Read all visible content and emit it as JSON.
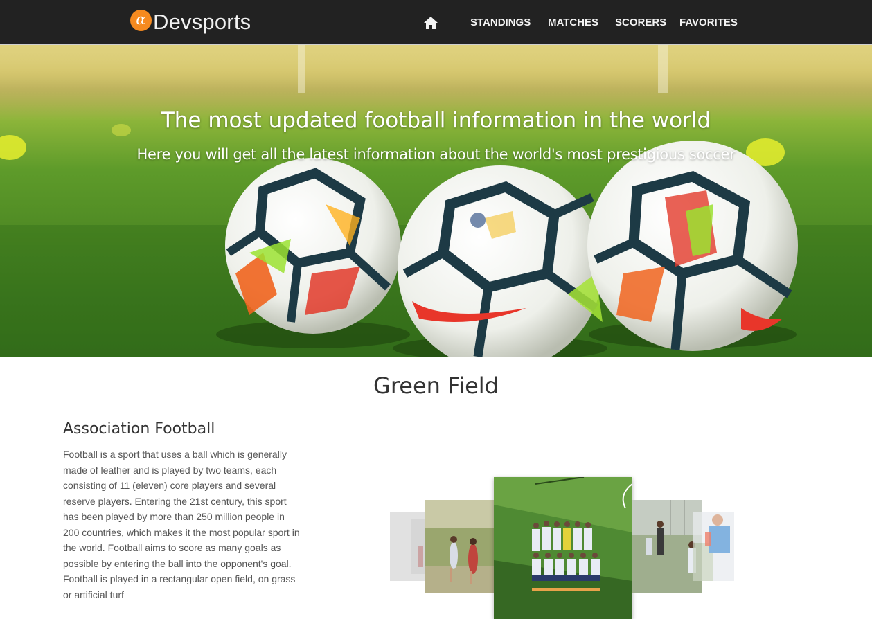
{
  "header": {
    "brand_logo_glyph": "α",
    "brand_name": "Devsports",
    "home_icon": "home-icon",
    "nav": {
      "standings": "STANDINGS",
      "matches": "MATCHES",
      "scorers": "SCORERS",
      "favorites": "FAVORITES"
    }
  },
  "hero": {
    "title": "The most updated football information in the world",
    "subtitle": "Here you will get all the latest information about the world's most prestigious soccer"
  },
  "section": {
    "title": "Green Field"
  },
  "article": {
    "title": "Association Football",
    "body": "Football is a sport that uses a ball which is generally made of leather and is played by two teams, each consisting of 11 (eleven) core players and several reserve players. Entering the 21st century, this sport has been played by more than 250 million people in 200 countries, which makes it the most popular sport in the world. Football aims to score as many goals as possible by entering the ball into the opponent's goal. Football is played in a rectangular open field, on grass or artificial turf"
  },
  "colors": {
    "header_bg": "#222222",
    "brand_accent": "#f58a1f",
    "text_dark": "#333333",
    "text_body": "#555555"
  }
}
